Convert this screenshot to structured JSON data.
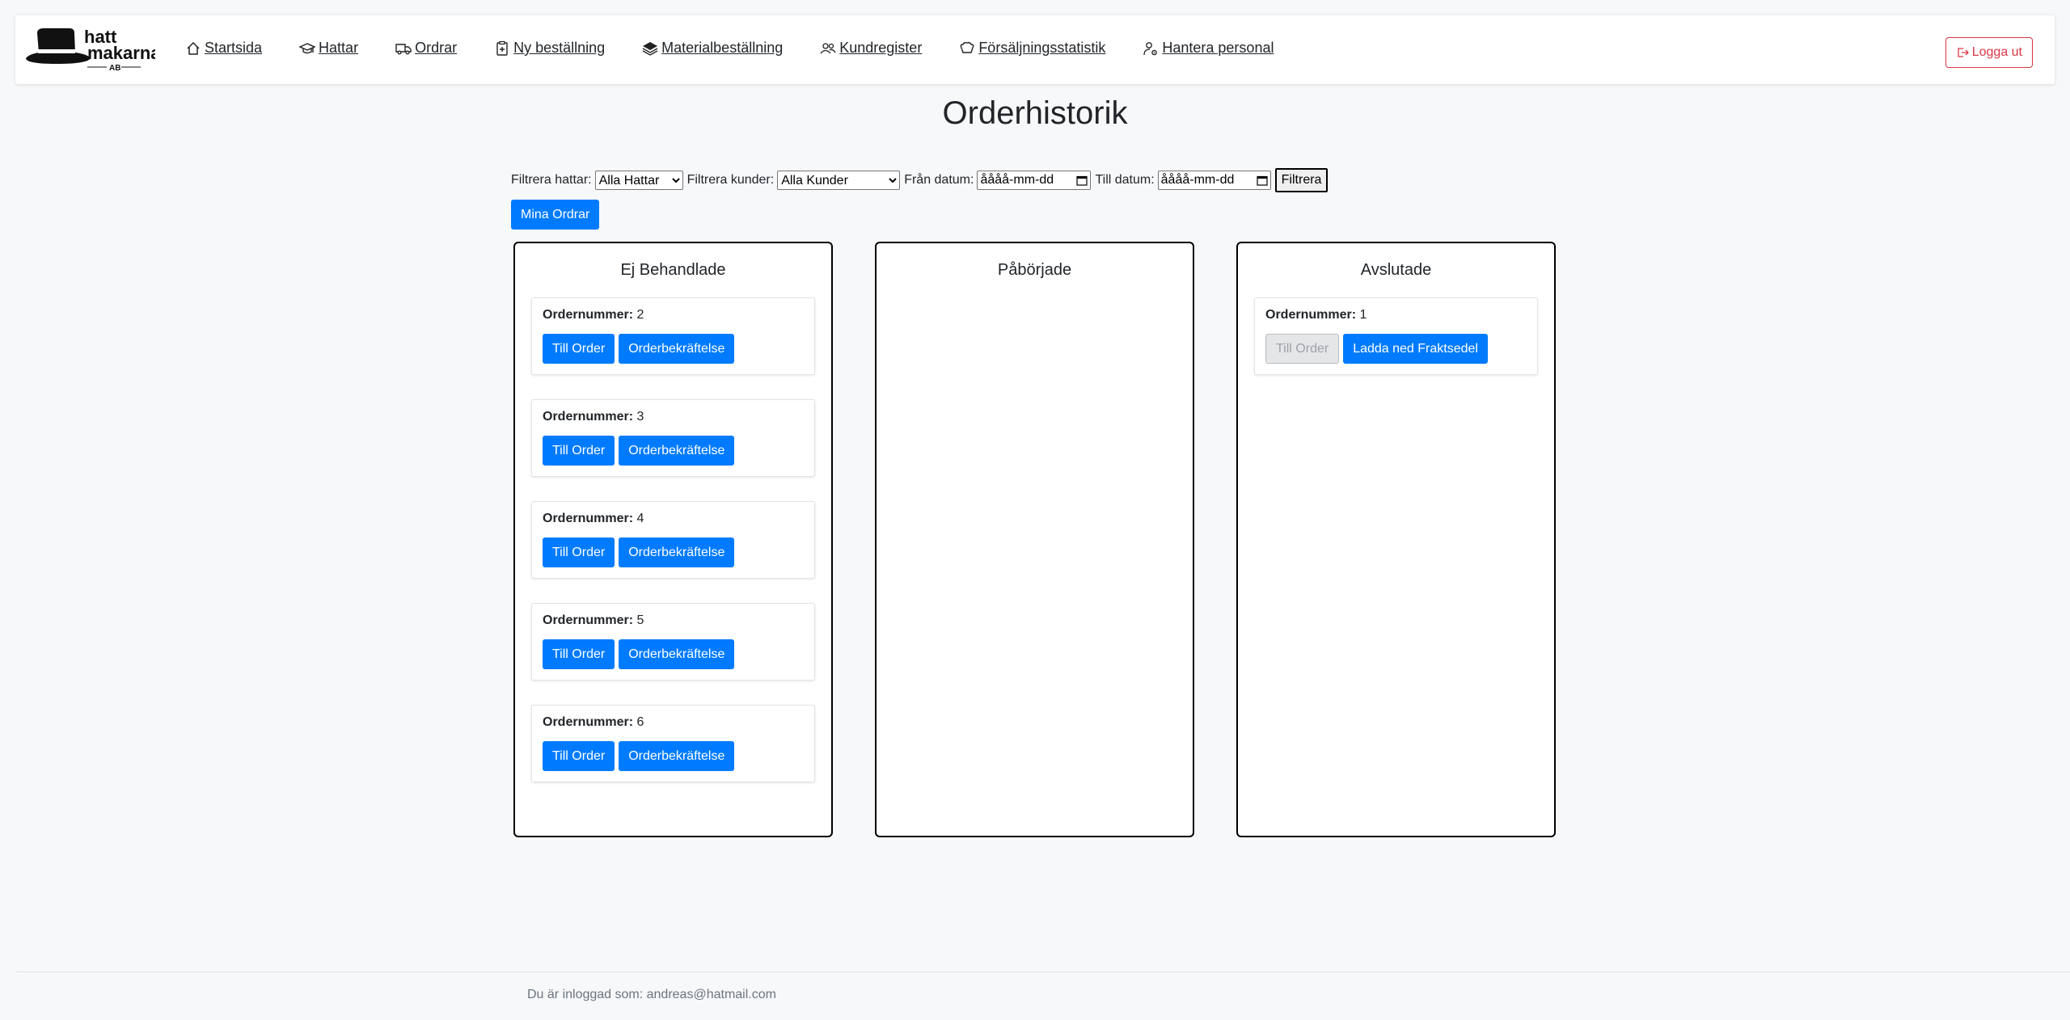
{
  "nav": {
    "logo_text_line1": "hatt",
    "logo_text_line2": "makarna",
    "logo_text_line3": "AB",
    "items": [
      {
        "label": "Startsida",
        "icon": "house-icon"
      },
      {
        "label": "Hattar",
        "icon": "graduation-cap-icon"
      },
      {
        "label": "Ordrar",
        "icon": "truck-icon"
      },
      {
        "label": "Ny beställning",
        "icon": "clipboard-plus-icon"
      },
      {
        "label": "Materialbeställning",
        "icon": "layers-icon"
      },
      {
        "label": "Kundregister",
        "icon": "people-icon"
      },
      {
        "label": "Försäljningsstatistik",
        "icon": "chef-hat-icon"
      },
      {
        "label": "Hantera personal",
        "icon": "person-gear-icon"
      }
    ],
    "logout_label": "Logga ut"
  },
  "page": {
    "title": "Orderhistorik"
  },
  "filters": {
    "hat_label": "Filtrera hattar:",
    "hat_selected": "Alla Hattar",
    "customer_label": "Filtrera kunder:",
    "customer_selected": "Alla Kunder",
    "from_label": "Från datum:",
    "from_value": "åååå-mm-dd",
    "to_label": "Till datum:",
    "to_value": "åååå-mm-dd",
    "filter_button": "Filtrera",
    "my_orders_button": "Mina Ordrar"
  },
  "columns": [
    {
      "title": "Ej Behandlade",
      "orders": [
        {
          "label": "Ordernummer:",
          "number": "2",
          "btn1": "Till Order",
          "btn2": "Orderbekräftelse"
        },
        {
          "label": "Ordernummer:",
          "number": "3",
          "btn1": "Till Order",
          "btn2": "Orderbekräftelse"
        },
        {
          "label": "Ordernummer:",
          "number": "4",
          "btn1": "Till Order",
          "btn2": "Orderbekräftelse"
        },
        {
          "label": "Ordernummer:",
          "number": "5",
          "btn1": "Till Order",
          "btn2": "Orderbekräftelse"
        },
        {
          "label": "Ordernummer:",
          "number": "6",
          "btn1": "Till Order",
          "btn2": "Orderbekräftelse"
        }
      ]
    },
    {
      "title": "Påbörjade",
      "orders": []
    },
    {
      "title": "Avslutade",
      "orders": [
        {
          "label": "Ordernummer:",
          "number": "1",
          "btn1": "Till Order",
          "btn2": "Ladda ned Fraktsedel"
        }
      ]
    }
  ],
  "footer": {
    "logged_in_text": "Du är inloggad som: andreas@hatmail.com"
  },
  "colors": {
    "primary": "#007bff",
    "danger": "#dc3545",
    "background": "#f7f8fa"
  }
}
